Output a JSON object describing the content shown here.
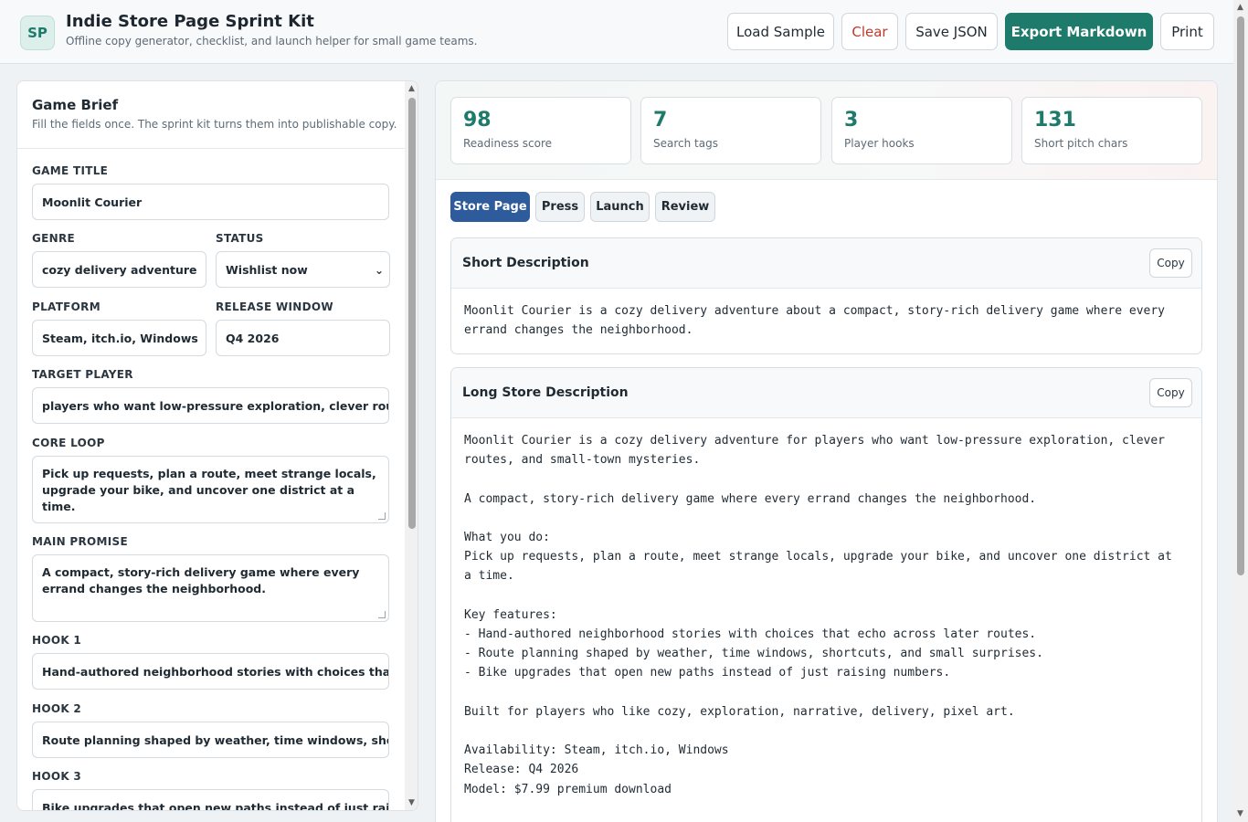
{
  "app": {
    "logo": "SP",
    "title": "Indie Store Page Sprint Kit",
    "subtitle": "Offline copy generator, checklist, and launch helper for small game teams."
  },
  "toolbar": {
    "load_sample": "Load Sample",
    "clear": "Clear",
    "save_json": "Save JSON",
    "export_markdown": "Export Markdown",
    "print": "Print"
  },
  "brief": {
    "title": "Game Brief",
    "subtitle": "Fill the fields once. The sprint kit turns them into publishable copy.",
    "fields": {
      "game_title": {
        "label": "GAME TITLE",
        "value": "Moonlit Courier"
      },
      "genre": {
        "label": "GENRE",
        "value": "cozy delivery adventure"
      },
      "status": {
        "label": "STATUS",
        "value": "Wishlist now"
      },
      "platform": {
        "label": "PLATFORM",
        "value": "Steam, itch.io, Windows"
      },
      "release_window": {
        "label": "RELEASE WINDOW",
        "value": "Q4 2026"
      },
      "target_player": {
        "label": "TARGET PLAYER",
        "value": "players who want low-pressure exploration, clever routes, and small-town mysteries"
      },
      "core_loop": {
        "label": "CORE LOOP",
        "value": "Pick up requests, plan a route, meet strange locals, upgrade your bike, and uncover one district at a time."
      },
      "main_promise": {
        "label": "MAIN PROMISE",
        "value": "A compact, story-rich delivery game where every errand changes the neighborhood."
      },
      "hook1": {
        "label": "HOOK 1",
        "value": "Hand-authored neighborhood stories with choices that echo across later routes."
      },
      "hook2": {
        "label": "HOOK 2",
        "value": "Route planning shaped by weather, time windows, shortcuts, and small surprises."
      },
      "hook3": {
        "label": "HOOK 3",
        "value": "Bike upgrades that open new paths instead of just raising numbers."
      }
    }
  },
  "stats": [
    {
      "value": "98",
      "label": "Readiness score"
    },
    {
      "value": "7",
      "label": "Search tags"
    },
    {
      "value": "3",
      "label": "Player hooks"
    },
    {
      "value": "131",
      "label": "Short pitch chars"
    }
  ],
  "tabs": [
    {
      "label": "Store Page"
    },
    {
      "label": "Press"
    },
    {
      "label": "Launch"
    },
    {
      "label": "Review"
    }
  ],
  "cards": {
    "short": {
      "title": "Short Description",
      "copy_label": "Copy",
      "body": "Moonlit Courier is a cozy delivery adventure about a compact, story-rich delivery game where every errand changes the neighborhood."
    },
    "long": {
      "title": "Long Store Description",
      "copy_label": "Copy",
      "body": "Moonlit Courier is a cozy delivery adventure for players who want low-pressure exploration, clever routes, and small-town mysteries.\n\nA compact, story-rich delivery game where every errand changes the neighborhood.\n\nWhat you do:\nPick up requests, plan a route, meet strange locals, upgrade your bike, and uncover one district at a time.\n\nKey features:\n- Hand-authored neighborhood stories with choices that echo across later routes.\n- Route planning shaped by weather, time windows, shortcuts, and small surprises.\n- Bike upgrades that open new paths instead of just raising numbers.\n\nBuilt for players who like cozy, exploration, narrative, delivery, pixel art.\n\nAvailability: Steam, itch.io, Windows\nRelease: Q4 2026\nModel: $7.99 premium download"
    }
  },
  "colors": {
    "accent": "#1e7a6b",
    "tab_active": "#2d5b9b",
    "danger": "#c0392b"
  }
}
